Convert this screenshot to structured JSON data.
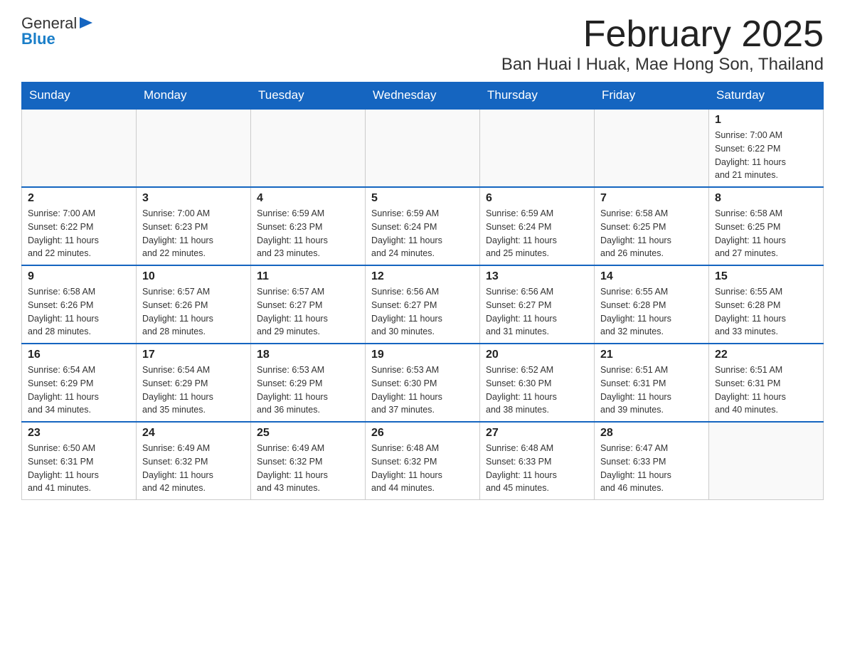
{
  "header": {
    "logo_general": "General",
    "logo_blue": "Blue",
    "title": "February 2025",
    "subtitle": "Ban Huai I Huak, Mae Hong Son, Thailand"
  },
  "weekdays": [
    "Sunday",
    "Monday",
    "Tuesday",
    "Wednesday",
    "Thursday",
    "Friday",
    "Saturday"
  ],
  "weeks": [
    {
      "days": [
        {
          "num": "",
          "info": ""
        },
        {
          "num": "",
          "info": ""
        },
        {
          "num": "",
          "info": ""
        },
        {
          "num": "",
          "info": ""
        },
        {
          "num": "",
          "info": ""
        },
        {
          "num": "",
          "info": ""
        },
        {
          "num": "1",
          "info": "Sunrise: 7:00 AM\nSunset: 6:22 PM\nDaylight: 11 hours\nand 21 minutes."
        }
      ]
    },
    {
      "days": [
        {
          "num": "2",
          "info": "Sunrise: 7:00 AM\nSunset: 6:22 PM\nDaylight: 11 hours\nand 22 minutes."
        },
        {
          "num": "3",
          "info": "Sunrise: 7:00 AM\nSunset: 6:23 PM\nDaylight: 11 hours\nand 22 minutes."
        },
        {
          "num": "4",
          "info": "Sunrise: 6:59 AM\nSunset: 6:23 PM\nDaylight: 11 hours\nand 23 minutes."
        },
        {
          "num": "5",
          "info": "Sunrise: 6:59 AM\nSunset: 6:24 PM\nDaylight: 11 hours\nand 24 minutes."
        },
        {
          "num": "6",
          "info": "Sunrise: 6:59 AM\nSunset: 6:24 PM\nDaylight: 11 hours\nand 25 minutes."
        },
        {
          "num": "7",
          "info": "Sunrise: 6:58 AM\nSunset: 6:25 PM\nDaylight: 11 hours\nand 26 minutes."
        },
        {
          "num": "8",
          "info": "Sunrise: 6:58 AM\nSunset: 6:25 PM\nDaylight: 11 hours\nand 27 minutes."
        }
      ]
    },
    {
      "days": [
        {
          "num": "9",
          "info": "Sunrise: 6:58 AM\nSunset: 6:26 PM\nDaylight: 11 hours\nand 28 minutes."
        },
        {
          "num": "10",
          "info": "Sunrise: 6:57 AM\nSunset: 6:26 PM\nDaylight: 11 hours\nand 28 minutes."
        },
        {
          "num": "11",
          "info": "Sunrise: 6:57 AM\nSunset: 6:27 PM\nDaylight: 11 hours\nand 29 minutes."
        },
        {
          "num": "12",
          "info": "Sunrise: 6:56 AM\nSunset: 6:27 PM\nDaylight: 11 hours\nand 30 minutes."
        },
        {
          "num": "13",
          "info": "Sunrise: 6:56 AM\nSunset: 6:27 PM\nDaylight: 11 hours\nand 31 minutes."
        },
        {
          "num": "14",
          "info": "Sunrise: 6:55 AM\nSunset: 6:28 PM\nDaylight: 11 hours\nand 32 minutes."
        },
        {
          "num": "15",
          "info": "Sunrise: 6:55 AM\nSunset: 6:28 PM\nDaylight: 11 hours\nand 33 minutes."
        }
      ]
    },
    {
      "days": [
        {
          "num": "16",
          "info": "Sunrise: 6:54 AM\nSunset: 6:29 PM\nDaylight: 11 hours\nand 34 minutes."
        },
        {
          "num": "17",
          "info": "Sunrise: 6:54 AM\nSunset: 6:29 PM\nDaylight: 11 hours\nand 35 minutes."
        },
        {
          "num": "18",
          "info": "Sunrise: 6:53 AM\nSunset: 6:29 PM\nDaylight: 11 hours\nand 36 minutes."
        },
        {
          "num": "19",
          "info": "Sunrise: 6:53 AM\nSunset: 6:30 PM\nDaylight: 11 hours\nand 37 minutes."
        },
        {
          "num": "20",
          "info": "Sunrise: 6:52 AM\nSunset: 6:30 PM\nDaylight: 11 hours\nand 38 minutes."
        },
        {
          "num": "21",
          "info": "Sunrise: 6:51 AM\nSunset: 6:31 PM\nDaylight: 11 hours\nand 39 minutes."
        },
        {
          "num": "22",
          "info": "Sunrise: 6:51 AM\nSunset: 6:31 PM\nDaylight: 11 hours\nand 40 minutes."
        }
      ]
    },
    {
      "days": [
        {
          "num": "23",
          "info": "Sunrise: 6:50 AM\nSunset: 6:31 PM\nDaylight: 11 hours\nand 41 minutes."
        },
        {
          "num": "24",
          "info": "Sunrise: 6:49 AM\nSunset: 6:32 PM\nDaylight: 11 hours\nand 42 minutes."
        },
        {
          "num": "25",
          "info": "Sunrise: 6:49 AM\nSunset: 6:32 PM\nDaylight: 11 hours\nand 43 minutes."
        },
        {
          "num": "26",
          "info": "Sunrise: 6:48 AM\nSunset: 6:32 PM\nDaylight: 11 hours\nand 44 minutes."
        },
        {
          "num": "27",
          "info": "Sunrise: 6:48 AM\nSunset: 6:33 PM\nDaylight: 11 hours\nand 45 minutes."
        },
        {
          "num": "28",
          "info": "Sunrise: 6:47 AM\nSunset: 6:33 PM\nDaylight: 11 hours\nand 46 minutes."
        },
        {
          "num": "",
          "info": ""
        }
      ]
    }
  ]
}
